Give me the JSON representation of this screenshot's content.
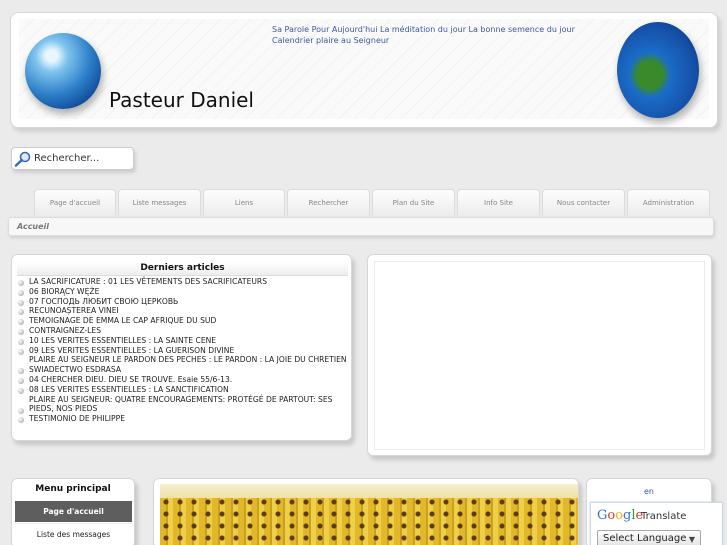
{
  "header": {
    "site_title": "Pasteur Daniel",
    "links_text": "Sa Parole Pour Aujourd'hui La méditation du jour La bonne semence du jour Calendrier plaire au Seigneur"
  },
  "search": {
    "placeholder": "Rechercher..."
  },
  "nav": {
    "tabs": [
      "Page d'accueil",
      "Liste messages",
      "Liens",
      "Rechercher",
      "Plan du Site",
      "Info Site",
      "Nous contacter",
      "Administration"
    ]
  },
  "breadcrumb": "Accueil",
  "articles": {
    "title": "Derniers articles",
    "items": [
      "LA SACRIFICATURE : 01 LES VÊTEMENTS DES SACRIFICATEURS",
      "06 BIORĄCY WĘŻE",
      "07 ГОСПОДЬ ЛЮБИТ СВОЮ ЦЕРКОВЬ",
      "RECUNOAȘTEREA VINEI",
      "TEMOIGNAGE DE EMMA LE CAP AFRIQUE DU SUD",
      "CONTRAIGNEZ-LES",
      "10 LES VERITES ESSENTIELLES : LA SAINTE CENE",
      "09 LES VERITES ESSENTIELLES : LA GUERISON DIVINE",
      "PLAIRE AU SEIGNEUR LE PARDON DES PECHES : LE PARDON : LA JOIE DU CHRETIEN",
      "SWIADECTWO ESDRASA",
      "04 CHERCHER DIEU. DIEU SE TROUVE. Esaie 55/6-13.",
      "08 LES VERITES ESSENTIELLES : LA SANCTIFICATION",
      "PLAIRE AU SEIGNEUR: QUATRE ENCOURAGEMENTS: PROTÉGÉ DE PARTOUT: SES PIEDS, NOS PIEDS",
      "TESTIMONIO DE PHILIPPE"
    ]
  },
  "menu": {
    "title": "Menu principal",
    "items": [
      "Page d'accueil",
      "Liste des messages"
    ]
  },
  "translate": {
    "lang_code": "en",
    "brand": "Google",
    "label": "Translate",
    "select_value": "Select Language"
  }
}
